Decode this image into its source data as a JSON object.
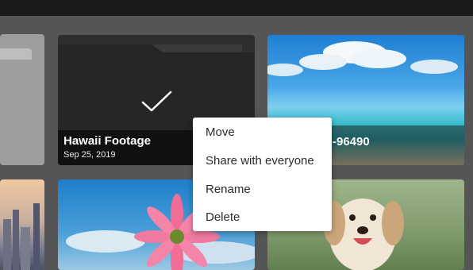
{
  "folder": {
    "title": "Hawaii Footage",
    "date": "Sep 25, 2019",
    "selected": true
  },
  "beach_tile": {
    "label_fragment": "-96490"
  },
  "context_menu": {
    "items": [
      "Move",
      "Share with everyone",
      "Rename",
      "Delete"
    ]
  },
  "colors": {
    "background": "#555555",
    "topbar": "#1a1a1a",
    "folder_dark": "#2e2e2e",
    "menu_bg": "#ffffff",
    "menu_text": "#2b2b2b"
  },
  "icons": [
    "checkmark-icon",
    "folder-icon"
  ]
}
